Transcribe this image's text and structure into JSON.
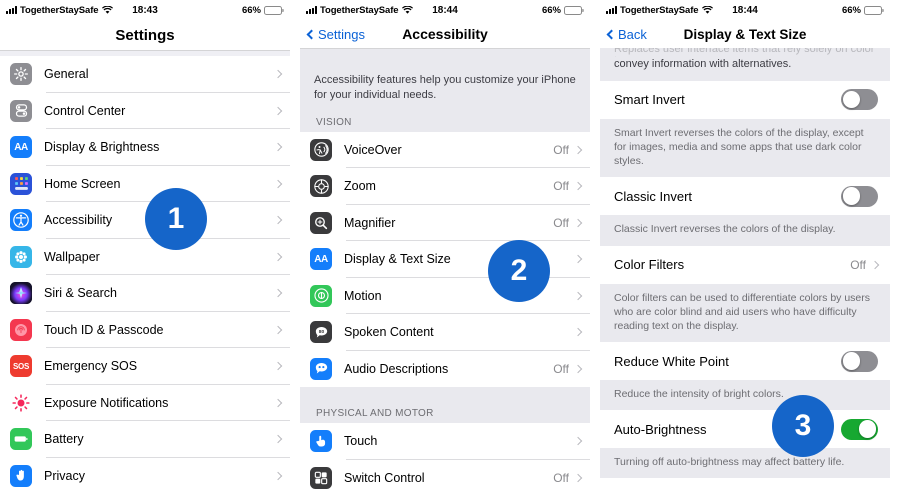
{
  "status_bar": {
    "carrier": "TogetherStaySafe",
    "time_panel1": "18:43",
    "time_panel2": "18:44",
    "time_panel3": "18:44",
    "battery_percent": "66%",
    "battery_color": "#e8820c",
    "signal_icon": "cellular-bars-icon",
    "wifi_icon": "wifi-icon",
    "battery_icon": "battery-icon"
  },
  "accent_color": "#0b62d6",
  "badge_color": "#1565C9",
  "panel1": {
    "nav": {
      "title": "Settings"
    },
    "items": [
      {
        "label": "General",
        "icon": "gear-icon",
        "icon_bg": "#8e8e93",
        "value": ""
      },
      {
        "label": "Control Center",
        "icon": "sliders-icon",
        "icon_bg": "#8e8e93",
        "value": ""
      },
      {
        "label": "Display & Brightness",
        "icon": "aa-icon",
        "icon_bg": "#147efb",
        "value": ""
      },
      {
        "label": "Home Screen",
        "icon": "app-grid-icon",
        "icon_bg": "#2b52d8",
        "value": ""
      },
      {
        "label": "Accessibility",
        "icon": "accessibility-icon",
        "icon_bg": "#147efb",
        "value": ""
      },
      {
        "label": "Wallpaper",
        "icon": "wallpaper-icon",
        "icon_bg": "#36b6e8",
        "value": ""
      },
      {
        "label": "Siri & Search",
        "icon": "siri-icon",
        "icon_bg": "#2a2a3a",
        "value": ""
      },
      {
        "label": "Touch ID & Passcode",
        "icon": "fingerprint-icon",
        "icon_bg": "#f4374f",
        "value": ""
      },
      {
        "label": "Emergency SOS",
        "icon": "sos-icon",
        "icon_bg": "#ee3b2f",
        "value": ""
      },
      {
        "label": "Exposure Notifications",
        "icon": "exposure-icon",
        "icon_bg": "#ffffff",
        "value": ""
      },
      {
        "label": "Battery",
        "icon": "battery-green-icon",
        "icon_bg": "#32c759",
        "value": ""
      },
      {
        "label": "Privacy",
        "icon": "hand-icon",
        "icon_bg": "#147efb",
        "value": ""
      }
    ],
    "badge": "1"
  },
  "panel2": {
    "nav": {
      "back_label": "Settings",
      "title": "Accessibility"
    },
    "blurb": "Accessibility features help you customize your iPhone for your individual needs.",
    "section_vision": "VISION",
    "vision_items": [
      {
        "label": "VoiceOver",
        "icon": "voiceover-icon",
        "icon_bg": "#3a3a3c",
        "value": "Off"
      },
      {
        "label": "Zoom",
        "icon": "zoom-icon",
        "icon_bg": "#3a3a3c",
        "value": "Off"
      },
      {
        "label": "Magnifier",
        "icon": "magnifier-icon",
        "icon_bg": "#3a3a3c",
        "value": "Off"
      },
      {
        "label": "Display & Text Size",
        "icon": "aa-icon",
        "icon_bg": "#147efb",
        "value": ""
      },
      {
        "label": "Motion",
        "icon": "motion-icon",
        "icon_bg": "#32c759",
        "value": ""
      },
      {
        "label": "Spoken Content",
        "icon": "spoken-icon",
        "icon_bg": "#3a3a3c",
        "value": ""
      },
      {
        "label": "Audio Descriptions",
        "icon": "audio-desc-icon",
        "icon_bg": "#147efb",
        "value": "Off"
      }
    ],
    "section_physical": "PHYSICAL AND MOTOR",
    "physical_items": [
      {
        "label": "Touch",
        "icon": "touch-icon",
        "icon_bg": "#147efb",
        "value": ""
      },
      {
        "label": "Switch Control",
        "icon": "switch-control-icon",
        "icon_bg": "#3a3a3c",
        "value": "Off"
      }
    ],
    "badge": "2"
  },
  "panel3": {
    "nav": {
      "back_label": "Back",
      "title": "Display & Text Size"
    },
    "clipped_note": "convey information with alternatives.",
    "rows": [
      {
        "label": "Smart Invert",
        "type": "toggle",
        "state": "off",
        "note": "Smart Invert reverses the colors of the display, except for images, media and some apps that use dark color styles."
      },
      {
        "label": "Classic Invert",
        "type": "toggle",
        "state": "off",
        "note": "Classic Invert reverses the colors of the display."
      },
      {
        "label": "Color Filters",
        "type": "link",
        "value": "Off",
        "note": "Color filters can be used to differentiate colors by users who are color blind and aid users who have difficulty reading text on the display."
      },
      {
        "label": "Reduce White Point",
        "type": "toggle",
        "state": "off",
        "note": "Reduce the intensity of bright colors."
      },
      {
        "label": "Auto-Brightness",
        "type": "toggle",
        "state": "on",
        "note": "Turning off auto-brightness may affect battery life."
      }
    ],
    "badge": "3"
  }
}
